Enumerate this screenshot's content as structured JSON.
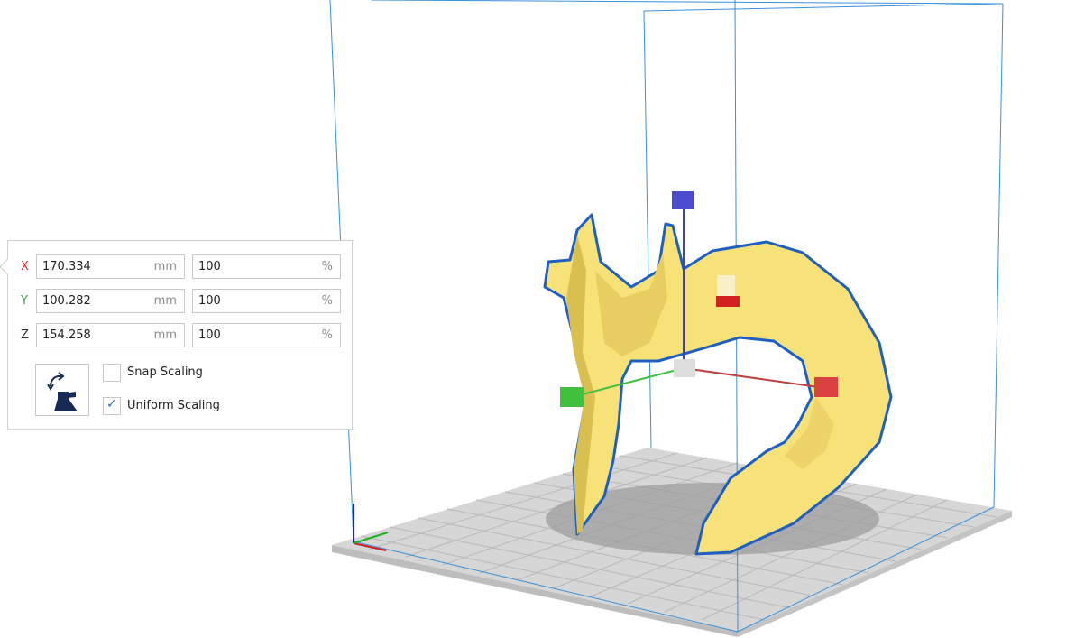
{
  "scale_tool": {
    "rows": [
      {
        "axis": "X",
        "axis_color": "#d32f2f",
        "mm": "170.334",
        "mm_unit": "mm",
        "percent": "100",
        "percent_unit": "%"
      },
      {
        "axis": "Y",
        "axis_color": "#43a047",
        "mm": "100.282",
        "mm_unit": "mm",
        "percent": "100",
        "percent_unit": "%"
      },
      {
        "axis": "Z",
        "axis_color": "#333333",
        "mm": "154.258",
        "mm_unit": "mm",
        "percent": "100",
        "percent_unit": "%"
      }
    ],
    "reset_icon": "reset-scale-icon",
    "snap_scaling": {
      "label": "Snap Scaling",
      "checked": false
    },
    "uniform_scaling": {
      "label": "Uniform Scaling",
      "checked": true
    }
  },
  "colors": {
    "build_volume_edge": "#3a8fd8",
    "model_fill": "#f7e27a",
    "model_outline": "#1f5fc0",
    "plate": "#c8c8c8",
    "handle_x": "#d94040",
    "handle_y": "#3fc03f",
    "handle_z": "#4040c0",
    "handle_center": "#dddddd"
  }
}
